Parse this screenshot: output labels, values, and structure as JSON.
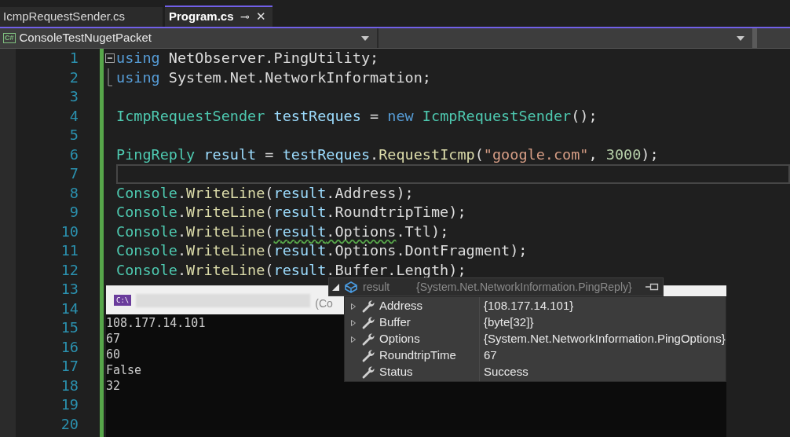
{
  "tabs": [
    {
      "label": "IcmpRequestSender.cs",
      "selected": false
    },
    {
      "label": "Program.cs",
      "selected": true,
      "pin": "⊸",
      "close": "✕"
    }
  ],
  "nav_bar": {
    "project_badge": "C#",
    "project": "ConsoleTestNugetPacket"
  },
  "editor": {
    "lines": [
      {
        "number": "1",
        "fold_start": true,
        "fold_end": false,
        "current": false,
        "tokens": [
          {
            "text": "using",
            "kind": "keyword"
          },
          {
            "text": " NetObserver.PingUtility;",
            "kind": "plain"
          }
        ]
      },
      {
        "number": "2",
        "fold_start": false,
        "fold_end": true,
        "current": false,
        "tokens": [
          {
            "text": "using",
            "kind": "keyword"
          },
          {
            "text": " System.Net.NetworkInformation;",
            "kind": "plain"
          }
        ]
      },
      {
        "number": "3",
        "current": false
      },
      {
        "number": "4",
        "current": false,
        "tokens": [
          {
            "text": "IcmpRequestSender",
            "kind": "type"
          },
          {
            "text": " testReques",
            "kind": "variable"
          },
          {
            "text": " = ",
            "kind": "plain"
          },
          {
            "text": "new",
            "kind": "keyword"
          },
          {
            "text": " IcmpRequestSender",
            "kind": "type"
          },
          {
            "text": "();",
            "kind": "plain"
          }
        ]
      },
      {
        "number": "5",
        "current": false
      },
      {
        "number": "6",
        "current": false,
        "tokens": [
          {
            "text": "PingReply",
            "kind": "type"
          },
          {
            "text": " result",
            "kind": "variable"
          },
          {
            "text": " = ",
            "kind": "plain"
          },
          {
            "text": "testReques",
            "kind": "variable"
          },
          {
            "text": ".",
            "kind": "plain"
          },
          {
            "text": "RequestIcmp",
            "kind": "method"
          },
          {
            "text": "(",
            "kind": "plain"
          },
          {
            "text": "\"google.com\"",
            "kind": "string"
          },
          {
            "text": ", ",
            "kind": "plain"
          },
          {
            "text": "3000",
            "kind": "number"
          },
          {
            "text": ");",
            "kind": "plain"
          }
        ]
      },
      {
        "number": "7",
        "current": true
      },
      {
        "number": "8",
        "current": false,
        "tokens": [
          {
            "text": "Console",
            "kind": "type"
          },
          {
            "text": ".",
            "kind": "plain"
          },
          {
            "text": "WriteLine",
            "kind": "method"
          },
          {
            "text": "(",
            "kind": "plain"
          },
          {
            "text": "result",
            "kind": "variable"
          },
          {
            "text": ".Address);",
            "kind": "plain"
          }
        ]
      },
      {
        "number": "9",
        "current": false,
        "tokens": [
          {
            "text": "Console",
            "kind": "type"
          },
          {
            "text": ".",
            "kind": "plain"
          },
          {
            "text": "WriteLine",
            "kind": "method"
          },
          {
            "text": "(",
            "kind": "plain"
          },
          {
            "text": "result",
            "kind": "variable"
          },
          {
            "text": ".RoundtripTime);",
            "kind": "plain"
          }
        ]
      },
      {
        "number": "10",
        "current": false,
        "tokens": [
          {
            "text": "Console",
            "kind": "type"
          },
          {
            "text": ".",
            "kind": "plain"
          },
          {
            "text": "WriteLine",
            "kind": "method"
          },
          {
            "text": "(",
            "kind": "plain"
          },
          {
            "text": "result",
            "kind": "variable",
            "squiggle": true
          },
          {
            "text": ".Options",
            "kind": "plain",
            "squiggle": true
          },
          {
            "text": ".Ttl);",
            "kind": "plain"
          }
        ]
      },
      {
        "number": "11",
        "current": false,
        "tokens": [
          {
            "text": "Console",
            "kind": "type"
          },
          {
            "text": ".",
            "kind": "plain"
          },
          {
            "text": "WriteLine",
            "kind": "method"
          },
          {
            "text": "(",
            "kind": "plain"
          },
          {
            "text": "result",
            "kind": "variable"
          },
          {
            "text": ".Options.DontFragment);",
            "kind": "plain"
          }
        ]
      },
      {
        "number": "12",
        "current": false,
        "tokens": [
          {
            "text": "Console",
            "kind": "type"
          },
          {
            "text": ".",
            "kind": "plain"
          },
          {
            "text": "WriteLine",
            "kind": "method"
          },
          {
            "text": "(",
            "kind": "plain"
          },
          {
            "text": "result",
            "kind": "variable"
          },
          {
            "text": ".Buffer.Length);",
            "kind": "plain"
          }
        ]
      },
      {
        "number": "13",
        "current": false
      },
      {
        "number": "14",
        "current": false
      },
      {
        "number": "15",
        "current": false
      },
      {
        "number": "16",
        "current": false
      },
      {
        "number": "17",
        "current": false
      },
      {
        "number": "18",
        "current": false
      },
      {
        "number": "19",
        "current": false
      },
      {
        "number": "20",
        "current": false
      }
    ]
  },
  "console_window": {
    "icon_text": "C:\\",
    "title_fragment": "(Co",
    "output": [
      "108.177.14.101",
      "67",
      "60",
      "False",
      "32"
    ]
  },
  "data_tip": {
    "name": "result",
    "value": "{System.Net.NetworkInformation.PingReply}",
    "members": [
      {
        "name": "Address",
        "value": "{108.177.14.101}",
        "expandable": true
      },
      {
        "name": "Buffer",
        "value": "{byte[32]}",
        "expandable": true
      },
      {
        "name": "Options",
        "value": "{System.Net.NetworkInformation.PingOptions}",
        "expandable": true
      },
      {
        "name": "RoundtripTime",
        "value": "67",
        "expandable": false
      },
      {
        "name": "Status",
        "value": "Success",
        "expandable": false
      }
    ]
  }
}
